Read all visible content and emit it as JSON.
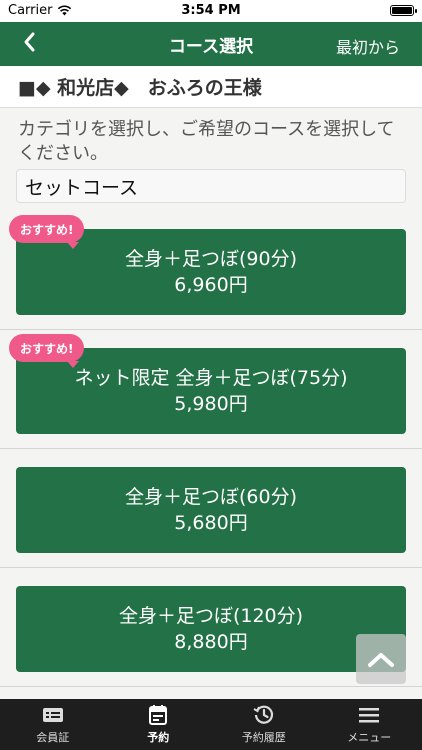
{
  "status_bar": {
    "carrier": "Carrier",
    "time": "3:54 PM"
  },
  "nav": {
    "back_icon": "chevron-left-icon",
    "title": "コース選択",
    "right_label": "最初から"
  },
  "store": {
    "name": "■◆ 和光店◆　おふろの王様"
  },
  "instruction": "カテゴリを選択し、ご希望のコースを選択してください。",
  "category": {
    "selected": "セットコース"
  },
  "courses": [
    {
      "name": "全身＋足つぼ(90分)",
      "price": "6,960円",
      "badge": "おすすめ!"
    },
    {
      "name": "ネット限定 全身＋足つぼ(75分)",
      "price": "5,980円",
      "badge": "おすすめ!"
    },
    {
      "name": "全身＋足つぼ(60分)",
      "price": "5,680円",
      "badge": ""
    },
    {
      "name": "全身＋足つぼ(120分)",
      "price": "8,880円",
      "badge": ""
    }
  ],
  "tabs": [
    {
      "label": "会員証",
      "icon": "member-card-icon",
      "active": false
    },
    {
      "label": "予約",
      "icon": "calendar-icon",
      "active": true
    },
    {
      "label": "予約履歴",
      "icon": "history-icon",
      "active": false
    },
    {
      "label": "メニュー",
      "icon": "menu-icon",
      "active": false
    }
  ],
  "colors": {
    "brand_green": "#237146",
    "badge_pink": "#f05a8b",
    "tabbar_bg": "#1e1e1e"
  }
}
